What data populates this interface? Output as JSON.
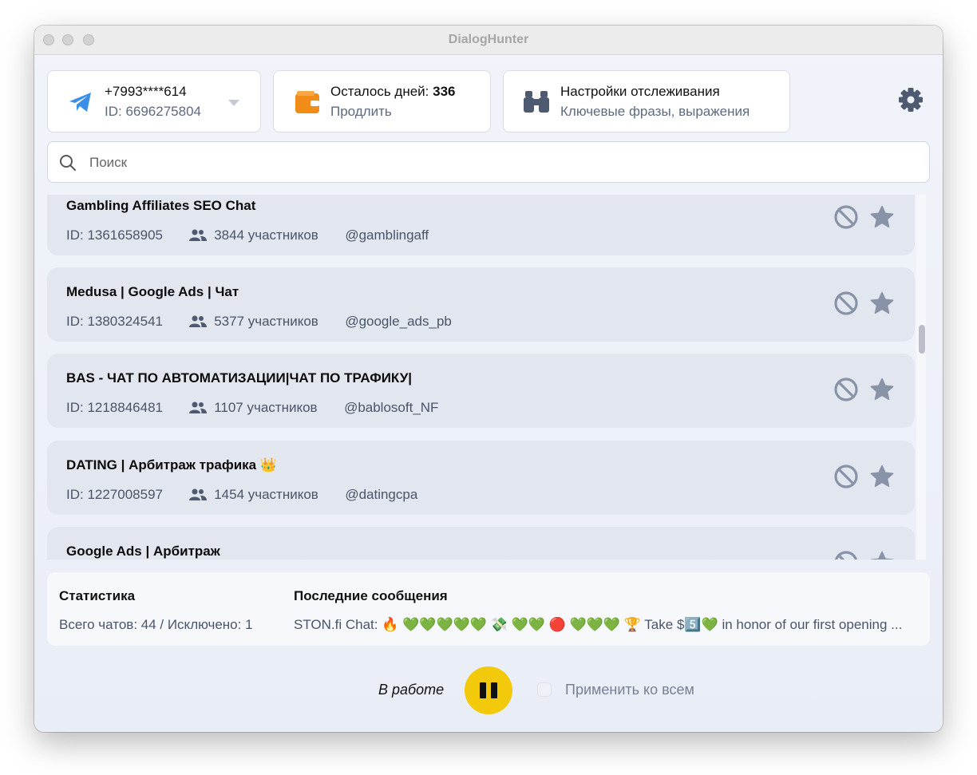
{
  "window": {
    "title": "DialogHunter"
  },
  "account": {
    "phone": "+7993****614",
    "id_text": "ID: 6696275804"
  },
  "subscription": {
    "days_label": "Осталось дней: ",
    "days_value": "336",
    "extend_label": "Продлить"
  },
  "tracking": {
    "title": "Настройки отслеживания",
    "subtitle": "Ключевые фразы, выражения"
  },
  "search": {
    "placeholder": "Поиск",
    "value": ""
  },
  "chats": [
    {
      "title": "Gambling Affiliates SEO Chat",
      "id_text": "ID: 1361658905",
      "members": "3844 участников",
      "username": "@gamblingaff"
    },
    {
      "title": "Medusa | Google Ads | Чат",
      "id_text": "ID: 1380324541",
      "members": "5377 участников",
      "username": "@google_ads_pb"
    },
    {
      "title": "BAS - ЧАТ ПО АВТОМАТИЗАЦИИ|ЧАТ ПО ТРАФИКУ|",
      "id_text": "ID: 1218846481",
      "members": "1107 участников",
      "username": "@bablosoft_NF"
    },
    {
      "title": "DATING | Арбитраж трафика 👑",
      "id_text": "ID: 1227008597",
      "members": "1454 участников",
      "username": "@datingcpa"
    },
    {
      "title": "Google Ads | Арбитраж",
      "id_text": "",
      "members": "",
      "username": ""
    }
  ],
  "stats": {
    "title": "Статистика",
    "summary": "Всего чатов: 44 / Исключено: 1",
    "messages_title": "Последние сообщения",
    "last_message": "STON.fi Chat: 🔥 💚💚💚💚💚 💸 💚💚 🔴 💚💚💚 🏆 Take $5️⃣💚 in honor of our first opening ..."
  },
  "footer": {
    "status": "В работе",
    "apply_all_label": "Применить ко всем",
    "apply_all_checked": false
  },
  "colors": {
    "accent_yellow": "#f3c90b",
    "telegram_blue": "#3b8fe6",
    "wallet_orange": "#f08c17",
    "icon_gray": "#8993a8"
  },
  "icons": [
    "telegram-icon",
    "chevron-down-icon",
    "wallet-icon",
    "binoculars-icon",
    "gear-icon",
    "search-icon",
    "users-icon",
    "ban-icon",
    "star-icon",
    "pause-icon"
  ]
}
